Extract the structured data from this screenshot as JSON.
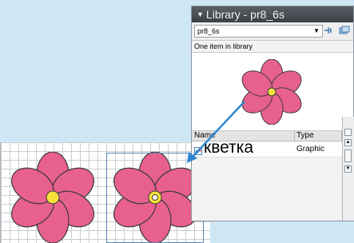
{
  "library_panel": {
    "title": "Library - pr8_6s",
    "selected_library": "pr8_6s",
    "item_count_text": "One item in library",
    "columns": {
      "name": "Name",
      "type": "Type"
    },
    "items": [
      {
        "name": "кветка",
        "type": "Graphic"
      }
    ]
  },
  "colors": {
    "petal": "#e8608e",
    "petal_stroke": "#3a3a3a",
    "center": "#f5e13a",
    "arrow": "#2f86d0",
    "panel_title_bg": "#4a4f55"
  },
  "icons": {
    "panel_menu": "triangle-down-icon",
    "pin": "pin-icon",
    "new_library": "new-library-icon",
    "symbol": "graphic-symbol-icon"
  }
}
